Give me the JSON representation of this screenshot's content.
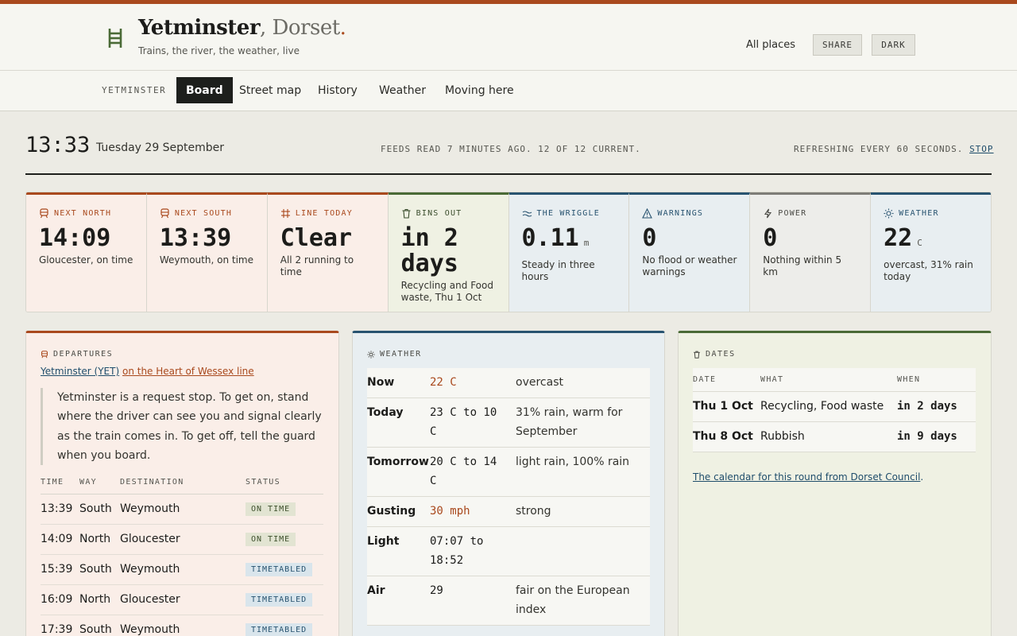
{
  "header": {
    "title": "Yetminster",
    "title_place": ", Dorset",
    "title_dot": ".",
    "tagline": "Trains, the river, the weather, live",
    "all_places": "All places",
    "share": "SHARE",
    "dark": "DARK"
  },
  "nav": {
    "place": "YETMINSTER",
    "tabs": [
      "Board",
      "Street map",
      "History",
      "Weather",
      "Moving here"
    ],
    "active": "Board"
  },
  "status": {
    "time": "13:33",
    "date": "Tuesday 29 September",
    "feeds": "FEEDS READ 7 MINUTES AGO. 12 OF 12 CURRENT.",
    "refresh": "REFRESHING EVERY 60 SECONDS.",
    "stop": "STOP"
  },
  "tiles": [
    {
      "icon": "train-icon",
      "label": "NEXT NORTH",
      "value": "14:09",
      "unit": "",
      "sub": "Gloucester, on time",
      "color": "#a9491d"
    },
    {
      "icon": "train-icon",
      "label": "NEXT SOUTH",
      "value": "13:39",
      "unit": "",
      "sub": "Weymouth, on time",
      "color": "#a9491d"
    },
    {
      "icon": "tracks-icon",
      "label": "LINE TODAY",
      "value": "Clear",
      "unit": "",
      "sub": "All 2 running to time",
      "color": "#a9491d"
    },
    {
      "icon": "bin-icon",
      "label": "BINS OUT",
      "value": "in 2 days",
      "unit": "",
      "sub": "Recycling and Food waste, Thu 1 Oct",
      "color": "#4a6a36"
    },
    {
      "icon": "water-icon",
      "label": "THE WRIGGLE",
      "value": "0.11",
      "unit": "m",
      "sub": "Steady in three hours",
      "color": "#285370"
    },
    {
      "icon": "warning-icon",
      "label": "WARNINGS",
      "value": "0",
      "unit": "",
      "sub": "No flood or weather warnings",
      "color": "#285370"
    },
    {
      "icon": "bolt-icon",
      "label": "POWER",
      "value": "0",
      "unit": "",
      "sub": "Nothing within 5 km",
      "color": "#7e7d77"
    },
    {
      "icon": "sun-icon",
      "label": "WEATHER",
      "value": "22",
      "unit": "C",
      "sub": "overcast, 31% rain today",
      "color": "#285370"
    }
  ],
  "departures": {
    "heading": "DEPARTURES",
    "station_link": "Yetminster (YET)",
    "line_link": "on the Heart of Wessex line",
    "note": "Yetminster is a request stop. To get on, stand where the driver can see you and signal clearly as the train comes in. To get off, tell the guard when you board.",
    "columns": [
      "TIME",
      "WAY",
      "DESTINATION",
      "STATUS"
    ],
    "rows": [
      {
        "time": "13:39",
        "way": "South",
        "dest": "Weymouth",
        "status": "ON TIME",
        "kind": "ontime"
      },
      {
        "time": "14:09",
        "way": "North",
        "dest": "Gloucester",
        "status": "ON TIME",
        "kind": "ontime"
      },
      {
        "time": "15:39",
        "way": "South",
        "dest": "Weymouth",
        "status": "TIMETABLED",
        "kind": "tt"
      },
      {
        "time": "16:09",
        "way": "North",
        "dest": "Gloucester",
        "status": "TIMETABLED",
        "kind": "tt"
      },
      {
        "time": "17:39",
        "way": "South",
        "dest": "Weymouth",
        "status": "TIMETABLED",
        "kind": "tt"
      }
    ]
  },
  "weather": {
    "heading": "WEATHER",
    "rows": [
      {
        "k": "Now",
        "v": "22 C",
        "d": "overcast",
        "hot": true
      },
      {
        "k": "Today",
        "v": "23 C to 10 C",
        "d": "31% rain, warm for September",
        "hot": false
      },
      {
        "k": "Tomorrow",
        "v": "20 C to 14 C",
        "d": "light rain, 100% rain",
        "hot": false
      },
      {
        "k": "Gusting",
        "v": "30 mph",
        "d": "strong",
        "hot": true
      },
      {
        "k": "Light",
        "v": "07:07 to 18:52",
        "d": "",
        "hot": false
      },
      {
        "k": "Air",
        "v": "29",
        "d": "fair on the European index",
        "hot": false
      }
    ]
  },
  "dates": {
    "heading": "DATES",
    "columns": [
      "DATE",
      "WHAT",
      "WHEN"
    ],
    "rows": [
      {
        "date": "Thu 1 Oct",
        "what": "Recycling, Food waste",
        "when": "in 2 days"
      },
      {
        "date": "Thu 8 Oct",
        "what": "Rubbish",
        "when": "in 9 days"
      }
    ],
    "council_link": "The calendar for this round from Dorset Council",
    "council_tail": "."
  }
}
